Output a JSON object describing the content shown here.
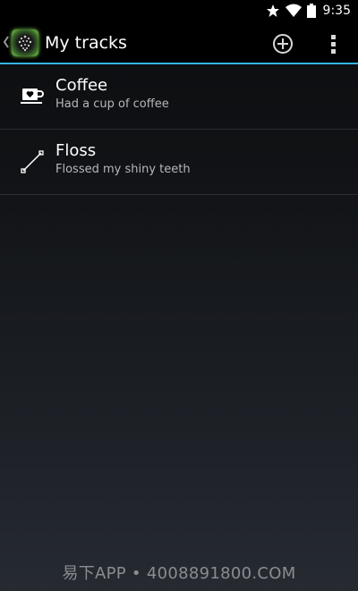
{
  "status_bar": {
    "time": "9:35",
    "icons": [
      "star-icon",
      "wifi-icon",
      "battery-icon"
    ]
  },
  "action_bar": {
    "title": "My tracks",
    "accent_color": "#33b5e5",
    "actions": [
      "add-icon",
      "overflow-menu-icon"
    ]
  },
  "tracks": [
    {
      "title": "Coffee",
      "subtitle": "Had a cup of coffee",
      "icon": "coffee-cup-icon"
    },
    {
      "title": "Floss",
      "subtitle": "Flossed my shiny teeth",
      "icon": "floss-line-icon"
    }
  ],
  "watermark": "易下APP • 4008891800.COM"
}
